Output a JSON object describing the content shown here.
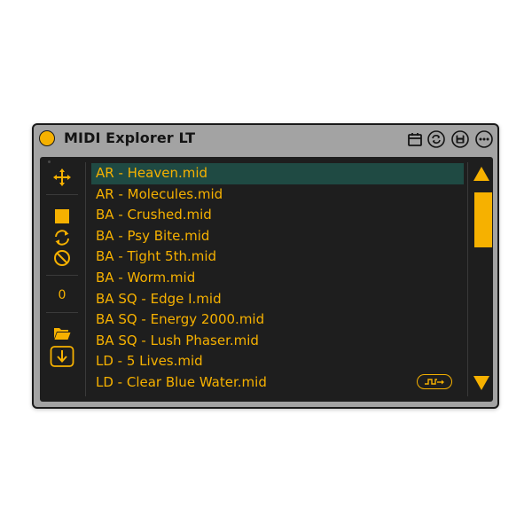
{
  "device": {
    "title": "MIDI Explorer LT",
    "accent_color": "#f6b100",
    "panel_color": "#1e1e1e",
    "selection_color": "#1f4a43"
  },
  "titlebar_icons": [
    "calendar-icon",
    "sync-icon",
    "save-icon",
    "more-icon"
  ],
  "sidebar": {
    "buttons": [
      "move-icon",
      "stop-icon",
      "loop-icon",
      "clear-icon",
      "folder-icon",
      "download-icon"
    ],
    "counter_value": "0"
  },
  "file_list": {
    "selected_index": 0,
    "items": [
      "AR - Heaven.mid",
      "AR - Molecules.mid",
      "BA - Crushed.mid",
      "BA - Psy Bite.mid",
      "BA - Tight 5th.mid",
      "BA - Worm.mid",
      "BA SQ - Edge I.mid",
      "BA SQ - Energy 2000.mid",
      "BA SQ - Lush Phaser.mid",
      "LD - 5 Lives.mid",
      "LD - Clear Blue Water.mid"
    ]
  },
  "scrollbar": {
    "up_icon": "scroll-up-arrow-icon",
    "down_icon": "scroll-down-arrow-icon"
  }
}
